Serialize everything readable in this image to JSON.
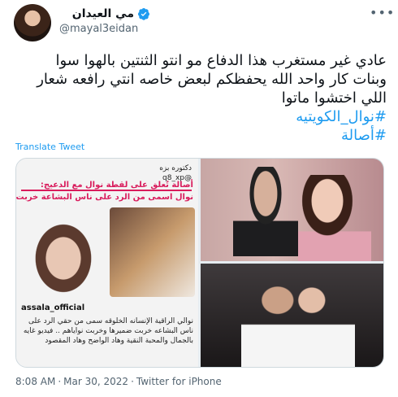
{
  "author": {
    "name": "مي العيدان",
    "handle": "@mayal3eidan",
    "verified": true
  },
  "menu_icon": "more-dots-icon",
  "tweet": {
    "lines": [
      "عادي غير مستغرب هذا الدفاع مو انتو الثنتين بالهوا سوا",
      "وبنات كار واحد الله يحفظكم لبعض خاصه انتي رافعه شعار",
      "اللي اختشوا ماتوا"
    ],
    "hashtags": [
      "#نوال_الكويتيه",
      "#أصالة"
    ]
  },
  "translate_label": "Translate Tweet",
  "media": {
    "tile1": {
      "source_label": "دكتوره بزه",
      "source_handle": "@q8_xp",
      "headline": "أصالة تُعلق على لقطة نوال مع الدعيج:",
      "subline": "نوال اسمى من الرد على ناس البشاعة خربت نواياهم",
      "ig_username": "assala_official",
      "ig_caption": "نوالي الراقية الإنسانه الخلوقه سمى من حقي الرد على ناس البشاعه خربت ضميرها وخربت نواياهم .. فيديو غايه بالجمال والمحبة النقية وهاد الواضح وهاد المقصود"
    }
  },
  "meta": {
    "time": "8:08 AM",
    "date": "Mar 30, 2022",
    "client": "Twitter for iPhone"
  },
  "colors": {
    "link": "#1d9bf0",
    "verified": "#1d9bf0",
    "secondary_text": "#536471"
  }
}
